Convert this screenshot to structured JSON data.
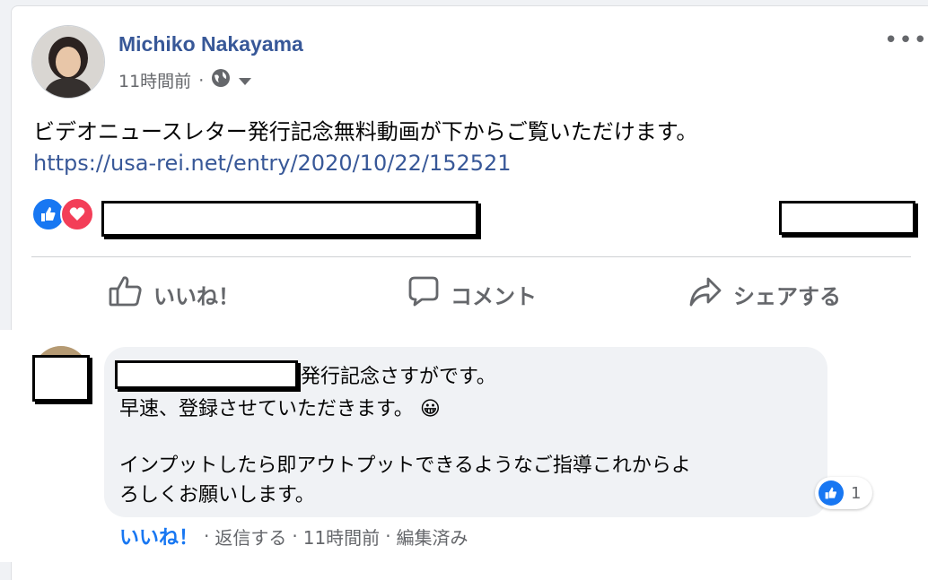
{
  "post": {
    "author": "Michiko Nakayama",
    "time": "11時間前",
    "separator": "·",
    "privacy_icon": "globe-icon",
    "text": "ビデオニュースレター発行記念無料動画が下からご覧いただけます。",
    "link": "https://usa-rei.net/entry/2020/10/22/152521",
    "more_label": "•••"
  },
  "reactions": [
    "like-icon",
    "love-icon"
  ],
  "actions": {
    "like": "いいね！",
    "comment": "コメント",
    "share": "シェアする"
  },
  "comment": {
    "line1_suffix": "発行記念さすがです。",
    "line2": "早速、登録させていただきます。",
    "emoji": "😀",
    "line3": "インプットしたら即アウトプットできるようなご指導これからよ",
    "line4": "ろしくお願いします。",
    "like_count": "1",
    "like_label": "いいね！",
    "reply_label": "返信する",
    "time": "11時間前",
    "edited": "編集済み",
    "separator": "·"
  },
  "colors": {
    "link": "#385898",
    "like_blue": "#1877f2",
    "love_red": "#f33e58",
    "muted": "#65676b"
  }
}
